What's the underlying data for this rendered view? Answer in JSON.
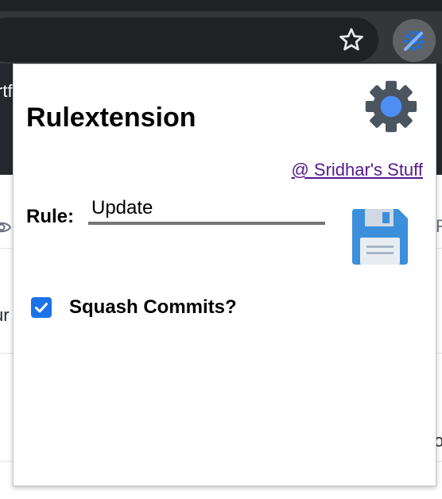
{
  "browser": {
    "toolbar": {
      "bookmark_icon": "star-icon",
      "extension_icon": "gear-wrench-icon"
    },
    "background_fragments": [
      "rtf",
      "ur",
      "F",
      "oc"
    ]
  },
  "popup": {
    "title": "Rulextension",
    "settings_icon": "gear-icon",
    "author_link": "@ Sridhar's Stuff",
    "rule": {
      "label": "Rule:",
      "value": "Update"
    },
    "save_icon": "floppy-disk-icon",
    "squash": {
      "label": "Squash Commits?",
      "checked": true
    }
  },
  "colors": {
    "gear_gray": "#4a5560",
    "gear_blue": "#4d8ef5",
    "floppy_blue": "#3b8fdb",
    "checkbox_blue": "#1a73e8",
    "link_purple": "#551a8b"
  }
}
